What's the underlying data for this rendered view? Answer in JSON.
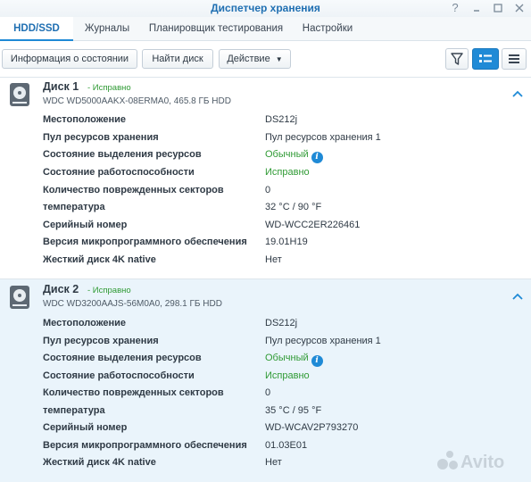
{
  "window": {
    "title": "Диспетчер хранения"
  },
  "tabs": [
    {
      "label": "HDD/SSD",
      "active": true
    },
    {
      "label": "Журналы"
    },
    {
      "label": "Планировщик тестирования"
    },
    {
      "label": "Настройки"
    }
  ],
  "toolbar": {
    "status_info_label": "Информация о состоянии",
    "find_disk_label": "Найти диск",
    "action_label": "Действие",
    "filter_icon": "filter-icon",
    "list_view_icon": "detail-list-icon",
    "compact_view_icon": "menu-list-icon"
  },
  "colors": {
    "accent": "#1f8ad6",
    "ok": "#2f9a34",
    "disk2_bg": "#eaf4fb"
  },
  "disks": [
    {
      "name": "Диск 1",
      "status": "- Исправно",
      "model": "WDC WD5000AAKX-08ERMA0, 465.8 ГБ HDD",
      "rows": [
        {
          "label": "Местоположение",
          "value": "DS212j"
        },
        {
          "label": "Пул ресурсов хранения",
          "value": "Пул ресурсов хранения 1"
        },
        {
          "label": "Состояние выделения ресурсов",
          "value": "Обычный"
        },
        {
          "label": "Состояние работоспособности",
          "value": "Исправно"
        },
        {
          "label": "Количество поврежденных секторов",
          "value": "0"
        },
        {
          "label": "температура",
          "value": "32 °C / 90 °F"
        },
        {
          "label": "Серийный номер",
          "value": "WD-WCC2ER226461"
        },
        {
          "label": "Версия микропрограммного обеспечения",
          "value": "19.01H19"
        },
        {
          "label": "Жесткий диск 4K native",
          "value": "Нет"
        }
      ]
    },
    {
      "name": "Диск 2",
      "status": "- Исправно",
      "model": "WDC WD3200AAJS-56M0A0, 298.1 ГБ HDD",
      "rows": [
        {
          "label": "Местоположение",
          "value": "DS212j"
        },
        {
          "label": "Пул ресурсов хранения",
          "value": "Пул ресурсов хранения 1"
        },
        {
          "label": "Состояние выделения ресурсов",
          "value": "Обычный"
        },
        {
          "label": "Состояние работоспособности",
          "value": "Исправно"
        },
        {
          "label": "Количество поврежденных секторов",
          "value": "0"
        },
        {
          "label": "температура",
          "value": "35 °C / 95 °F"
        },
        {
          "label": "Серийный номер",
          "value": "WD-WCAV2P793270"
        },
        {
          "label": "Версия микропрограммного обеспечения",
          "value": "01.03E01"
        },
        {
          "label": "Жесткий диск 4K native",
          "value": "Нет"
        }
      ]
    }
  ],
  "watermark": {
    "text": "Avito"
  }
}
